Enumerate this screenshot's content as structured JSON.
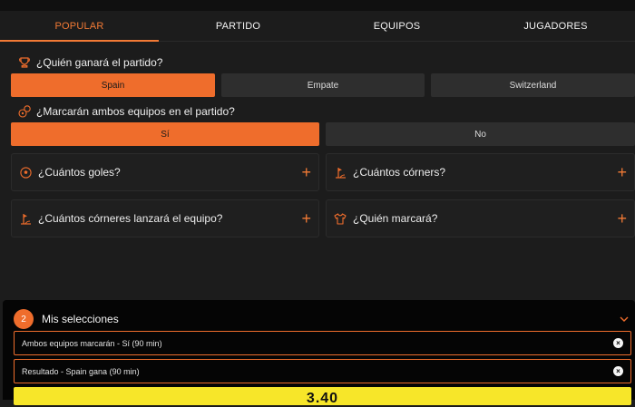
{
  "tabs": [
    {
      "label": "POPULAR",
      "active": true
    },
    {
      "label": "PARTIDO",
      "active": false
    },
    {
      "label": "EQUIPOS",
      "active": false
    },
    {
      "label": "JUGADORES",
      "active": false
    }
  ],
  "q1": {
    "icon": "trophy-icon",
    "text": "¿Quién ganará el partido?",
    "options": [
      "Spain",
      "Empate",
      "Switzerland"
    ],
    "selected": "Spain"
  },
  "q2": {
    "icon": "balls-icon",
    "text": "¿Marcarán ambos equipos en el partido?",
    "options": [
      "Sí",
      "No"
    ],
    "selected": "Sí"
  },
  "markets": [
    {
      "icon": "soccer-ball-icon",
      "text": "¿Cuántos goles?"
    },
    {
      "icon": "corner-flag-icon",
      "text": "¿Cuántos córners?"
    },
    {
      "icon": "corner-flag-icon",
      "text": "¿Cuántos córneres lanzará el equipo?"
    },
    {
      "icon": "shirt-icon",
      "text": "¿Quién marcará?"
    }
  ],
  "betslip": {
    "count": "2",
    "title": "Mis selecciones",
    "selections": [
      "Ambos equipos marcarán - Sí (90 min)",
      "Resultado - Spain gana (90 min)"
    ],
    "odds": "3.40"
  },
  "colors": {
    "accent": "#ef6d2c",
    "background": "#1c1c1c",
    "odds_bar": "#f7e629"
  }
}
